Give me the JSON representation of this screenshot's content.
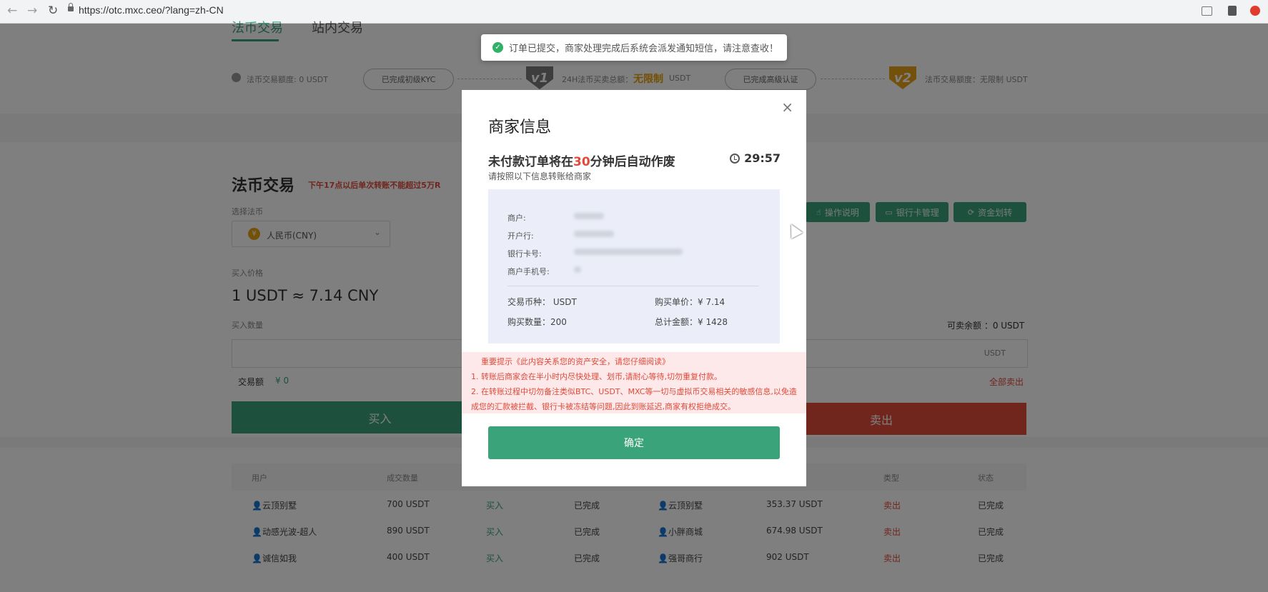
{
  "browser": {
    "url": "https://otc.mxc.ceo/?lang=zh-CN"
  },
  "top_tabs": [
    "法币交易",
    "站内交易"
  ],
  "kyc_bar": {
    "left_limit": "法币交易额度: 0 USDT",
    "pill1": "已完成初级KYC",
    "v1_badge": "v1",
    "daily_prefix": "24H法币买卖总额：",
    "daily_unlimited": "无限制",
    "daily_unit": "USDT",
    "pill2": "已完成高级认证",
    "v2_badge": "v2",
    "right_limit": "法币交易额度：无限制 USDT"
  },
  "trade": {
    "title": "法币交易",
    "warning": "下午17点以后单次转账不能超过5万R",
    "currency_label": "选择法币",
    "currency_value": "人民币(CNY)",
    "price_label": "买入价格",
    "price": "1 USDT ≈ 7.14 CNY",
    "amount_label": "买入数量",
    "amount_unit": "USDT",
    "total_label": "交易额",
    "total_value": "¥  0",
    "buy_button": "买入",
    "sell_button": "卖出",
    "available": "可卖余额 ：0 USDT",
    "sell_all": "全部卖出",
    "buttons": [
      "操作说明",
      "银行卡管理",
      "资金划转"
    ]
  },
  "table": {
    "headers": [
      "用户",
      "成交数量",
      "类型",
      "状态"
    ],
    "rows": [
      {
        "user1": "云顶别墅",
        "qty1": "700 USDT",
        "type1": "买入",
        "status1": "已完成",
        "user2": "云顶别墅",
        "qty2": "353.37 USDT",
        "type2": "卖出",
        "status2": "已完成"
      },
      {
        "user1": "动感光波-超人",
        "qty1": "890 USDT",
        "type1": "买入",
        "status1": "已完成",
        "user2": "小胖商城",
        "qty2": "674.98 USDT",
        "type2": "卖出",
        "status2": "已完成"
      },
      {
        "user1": "诚信如我",
        "qty1": "400 USDT",
        "type1": "买入",
        "status1": "已完成",
        "user2": "强哥商行",
        "qty2": "902 USDT",
        "type2": "卖出",
        "status2": "已完成"
      }
    ]
  },
  "toast": {
    "text": "订单已提交，商家处理完成后系统会派发通知短信，请注意查收！"
  },
  "modal": {
    "title": "商家信息",
    "close": "×",
    "warn_prefix": "未付款订单将在",
    "warn_minutes": "30",
    "warn_suffix": "分钟后自动作废",
    "timer": "29:57",
    "subtitle": "请按照以下信息转账给商家",
    "labels": {
      "merchant": "商户:",
      "bank": "开户行:",
      "card": "银行卡号:",
      "phone": "商户手机号:"
    },
    "currency_label": "交易币种：",
    "currency_value": "USDT",
    "unit_price_label": "购买单价：",
    "unit_price_value": "¥ 7.14",
    "qty_label": "购买数量：",
    "qty_value": "200",
    "total_label": "总计金额：",
    "total_value": "¥ 1428",
    "notice_title": "重要提示《此内容关系您的资产安全，请您仔细阅读》",
    "notice_1": "1. 转账后商家会在半小时内尽快处理、划币,请耐心等待,切勿重复付款。",
    "notice_2a": "2. 在转账过程中切勿备注类似BTC、USDT、MXC等一切与虚拟币交易相关的敏感信息,以免造",
    "notice_2b": "成您的汇款被拦截、银行卡被冻结等问题,因此到账延迟,商家有权拒绝成交。",
    "confirm": "确定"
  },
  "colors": {
    "green": "#3aa37a",
    "red": "#e04a3b",
    "overlay": "rgba(0,0,0,0.5)"
  }
}
